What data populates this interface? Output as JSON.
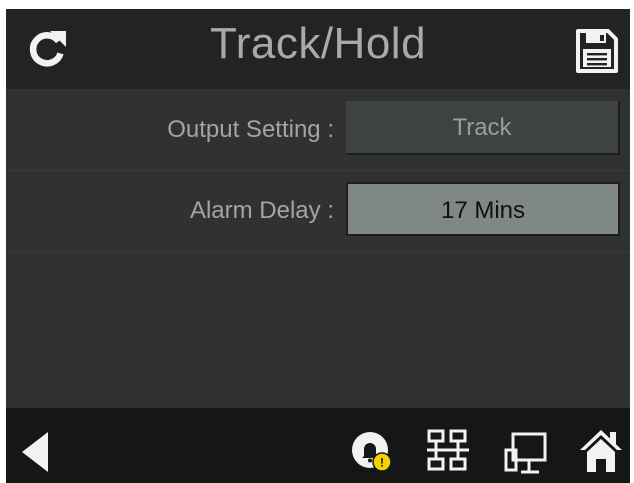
{
  "header": {
    "title": "Track/Hold",
    "refresh_icon": "refresh-icon",
    "save_icon": "save-icon"
  },
  "settings": [
    {
      "label": "Output Setting :",
      "value": "Track",
      "state": "inactive"
    },
    {
      "label": "Alarm Delay :",
      "value": "17 Mins",
      "state": "active"
    }
  ],
  "footer": {
    "alarm_badge": "!",
    "icons": [
      "back-arrow-icon",
      "alarm-bell-icon",
      "network-icon",
      "device-icon",
      "home-icon"
    ]
  },
  "colors": {
    "screen_bg": "#313131",
    "header_bg": "#232323",
    "footer_bg": "#161616",
    "text": "#a4a4a4",
    "button_inactive": "#3c4340",
    "button_active": "#7f8884",
    "badge": "#f2d300"
  }
}
